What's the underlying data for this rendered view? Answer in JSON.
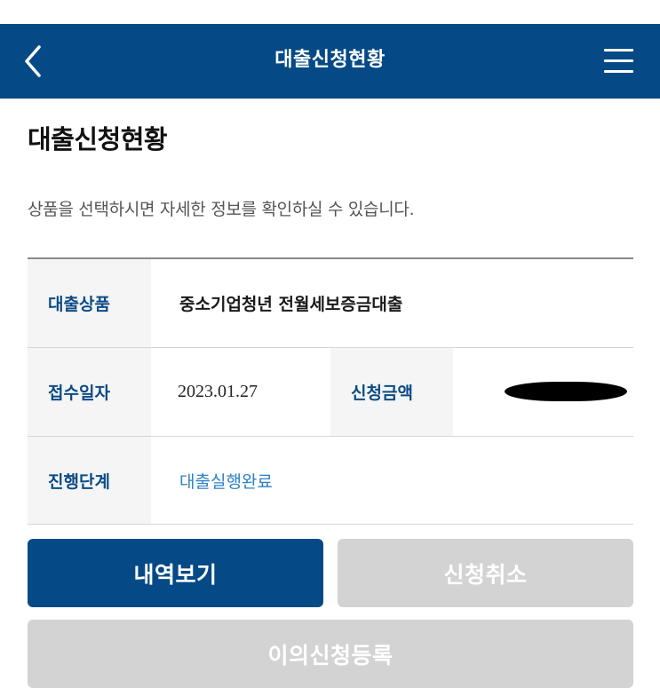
{
  "header": {
    "title": "대출신청현황",
    "back_icon": "chevron-left-icon",
    "menu_icon": "hamburger-menu-icon"
  },
  "page": {
    "title": "대출신청현황",
    "description": "상품을 선택하시면 자세한 정보를 확인하실 수 있습니다."
  },
  "details": {
    "product_label": "대출상품",
    "product_value": "중소기업청년 전월세보증금대출",
    "received_date_label": "접수일자",
    "received_date_value": "2023.01.27",
    "amount_label": "신청금액",
    "stage_label": "진행단계",
    "stage_value": "대출실행완료"
  },
  "actions": {
    "view_history": "내역보기",
    "cancel_application": "신청취소",
    "extension_register": "이의신청등록"
  },
  "colors": {
    "brand": "#054a86",
    "label_text": "#0c4b85",
    "status_text": "#2f80c8",
    "disabled_button": "#d3d3d3"
  }
}
